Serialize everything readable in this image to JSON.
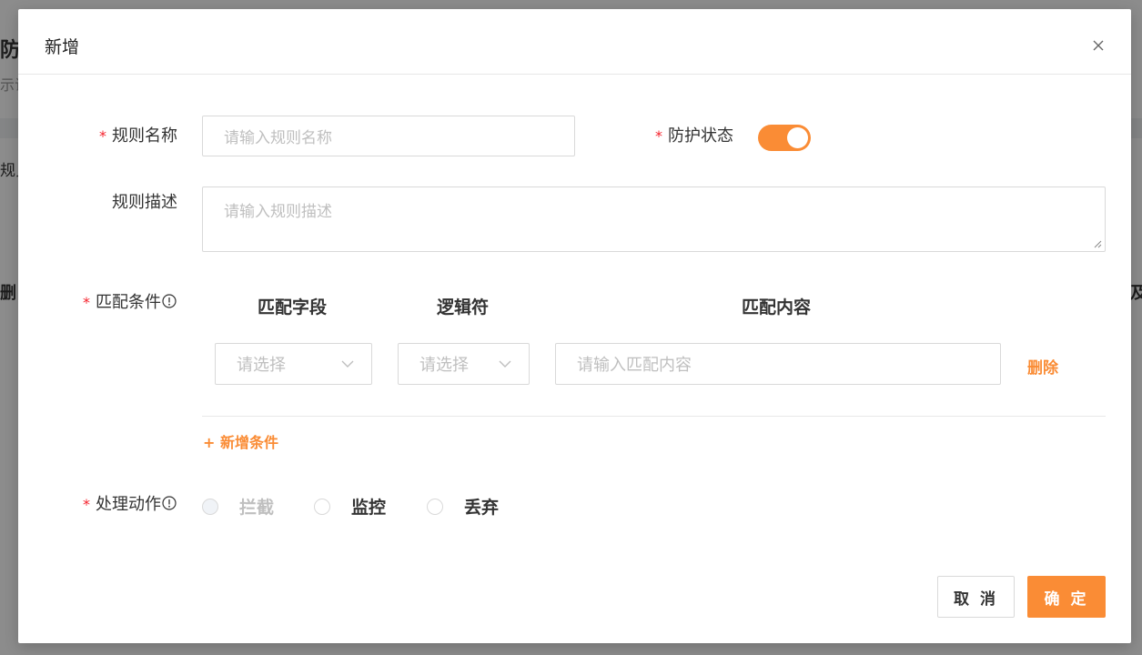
{
  "background": {
    "title_fragment": "防问",
    "subtitle_fragment": "示访",
    "tab_fragment": "规贝",
    "left_col_fragment": "删|",
    "right_col_fragment": "及"
  },
  "modal": {
    "title": "新增",
    "close_icon": "close-icon",
    "rule_name": {
      "label": "规则名称",
      "placeholder": "请输入规则名称",
      "required": true
    },
    "protect_status": {
      "label": "防护状态",
      "on": true,
      "required": true
    },
    "rule_desc": {
      "label": "规则描述",
      "placeholder": "请输入规则描述"
    },
    "match_conditions": {
      "label": "匹配条件",
      "required": true,
      "columns": [
        "匹配字段",
        "逻辑符",
        "匹配内容"
      ],
      "rows": [
        {
          "field_placeholder": "请选择",
          "operator_placeholder": "请选择",
          "content_placeholder": "请输入匹配内容",
          "delete_label": "删除"
        }
      ],
      "add_label": "+ 新增条件"
    },
    "action": {
      "label": "处理动作",
      "required": true,
      "options": [
        {
          "label": "拦截",
          "disabled": true
        },
        {
          "label": "监控",
          "disabled": false
        },
        {
          "label": "丢弃",
          "disabled": false
        }
      ]
    },
    "footer": {
      "cancel_label": "取 消",
      "ok_label": "确 定"
    }
  },
  "colors": {
    "accent": "#fa8c35",
    "required": "#f5222d",
    "mask": "rgba(0,0,0,0.45)"
  }
}
